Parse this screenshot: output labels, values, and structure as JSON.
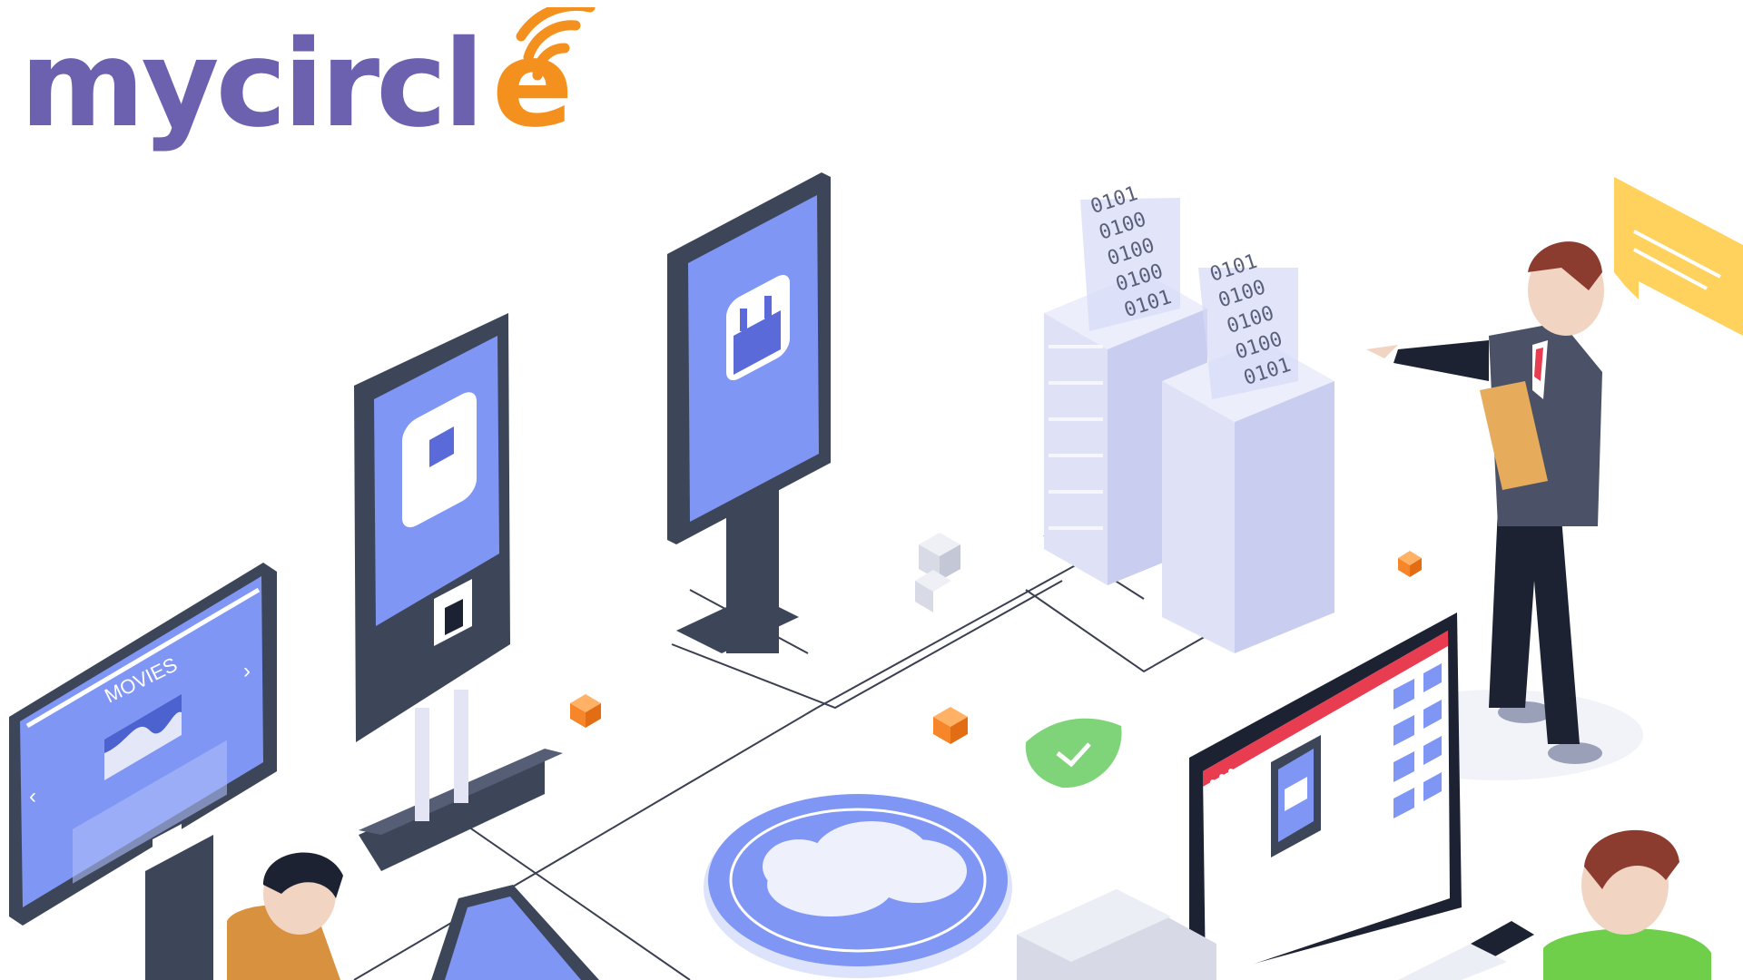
{
  "logo": {
    "text_main": "mycircl",
    "text_accent": "e",
    "brand_color": "#6b61ae",
    "accent_color": "#f4901e"
  },
  "binary_stack_a": [
    "0101",
    "0100",
    "0100",
    "0100",
    "0101"
  ],
  "binary_stack_b": [
    "0101",
    "0100",
    "0100",
    "0100",
    "0101"
  ],
  "kiosk_movies": {
    "label": "MOVIES"
  },
  "colors": {
    "screen": "#7f96f5",
    "device_dark": "#3d4659",
    "server": "#e4e6f8",
    "shield": "#7fd47a",
    "bubble": "#ffd25e",
    "cube": "#f7852a",
    "alert_red": "#e83c50"
  }
}
